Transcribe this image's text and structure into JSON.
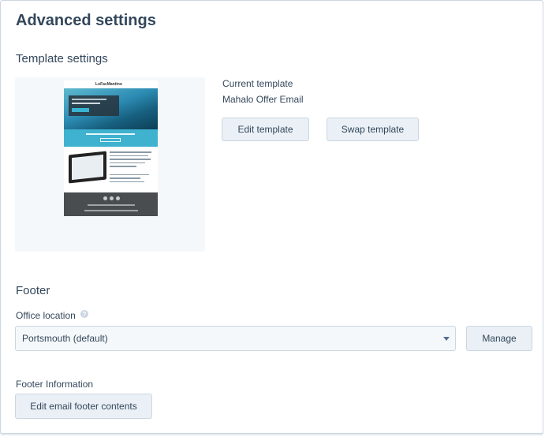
{
  "page": {
    "title": "Advanced settings"
  },
  "template_settings": {
    "heading": "Template settings",
    "current_label": "Current template",
    "current_value": "Mahalo Offer Email",
    "edit_button": "Edit template",
    "swap_button": "Swap template",
    "preview": {
      "brand": "LoFacMantino"
    }
  },
  "footer": {
    "heading": "Footer",
    "office_label": "Office location",
    "office_select_value": "Portsmouth (default)",
    "manage_button": "Manage",
    "info_label": "Footer Information",
    "edit_footer_button": "Edit email footer contents"
  },
  "colors": {
    "text": "#33475b",
    "button_bg": "#eaf0f6",
    "border": "#cbd6e2"
  }
}
